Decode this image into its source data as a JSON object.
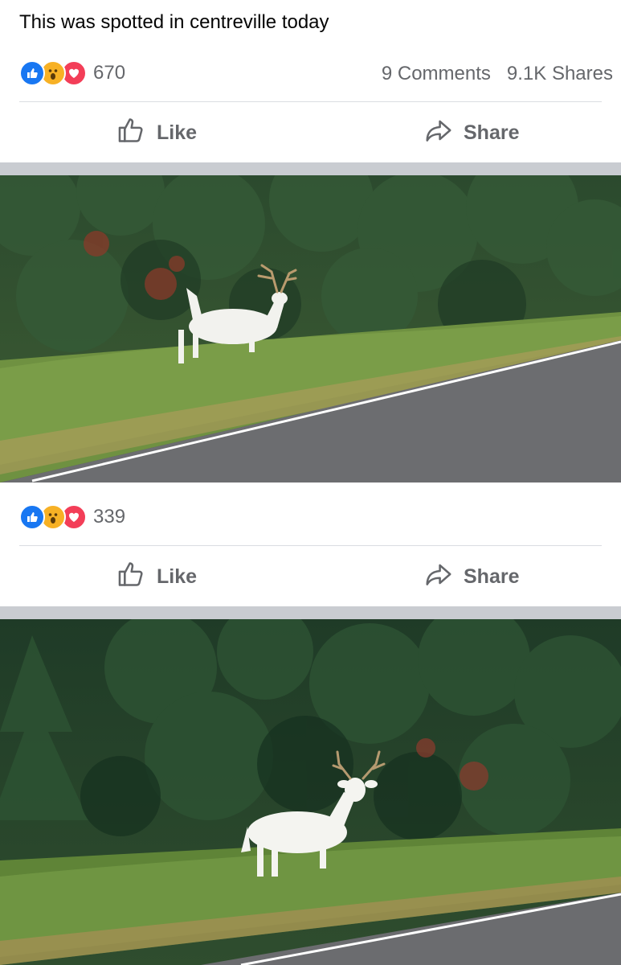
{
  "post": {
    "caption": "This was spotted in centreville today",
    "reaction_count": "670",
    "comments": "9 Comments",
    "shares": "9.1K Shares",
    "reaction_icons": [
      "like-icon",
      "wow-icon",
      "love-icon"
    ]
  },
  "actions": {
    "like_label": "Like",
    "share_label": "Share"
  },
  "photo2": {
    "reaction_count": "339"
  },
  "colors": {
    "like_blue": "#1877f2",
    "wow_yellow": "#f7b125",
    "love_red": "#f33e58",
    "muted_text": "#65676b",
    "separator": "#c9ccd1"
  }
}
